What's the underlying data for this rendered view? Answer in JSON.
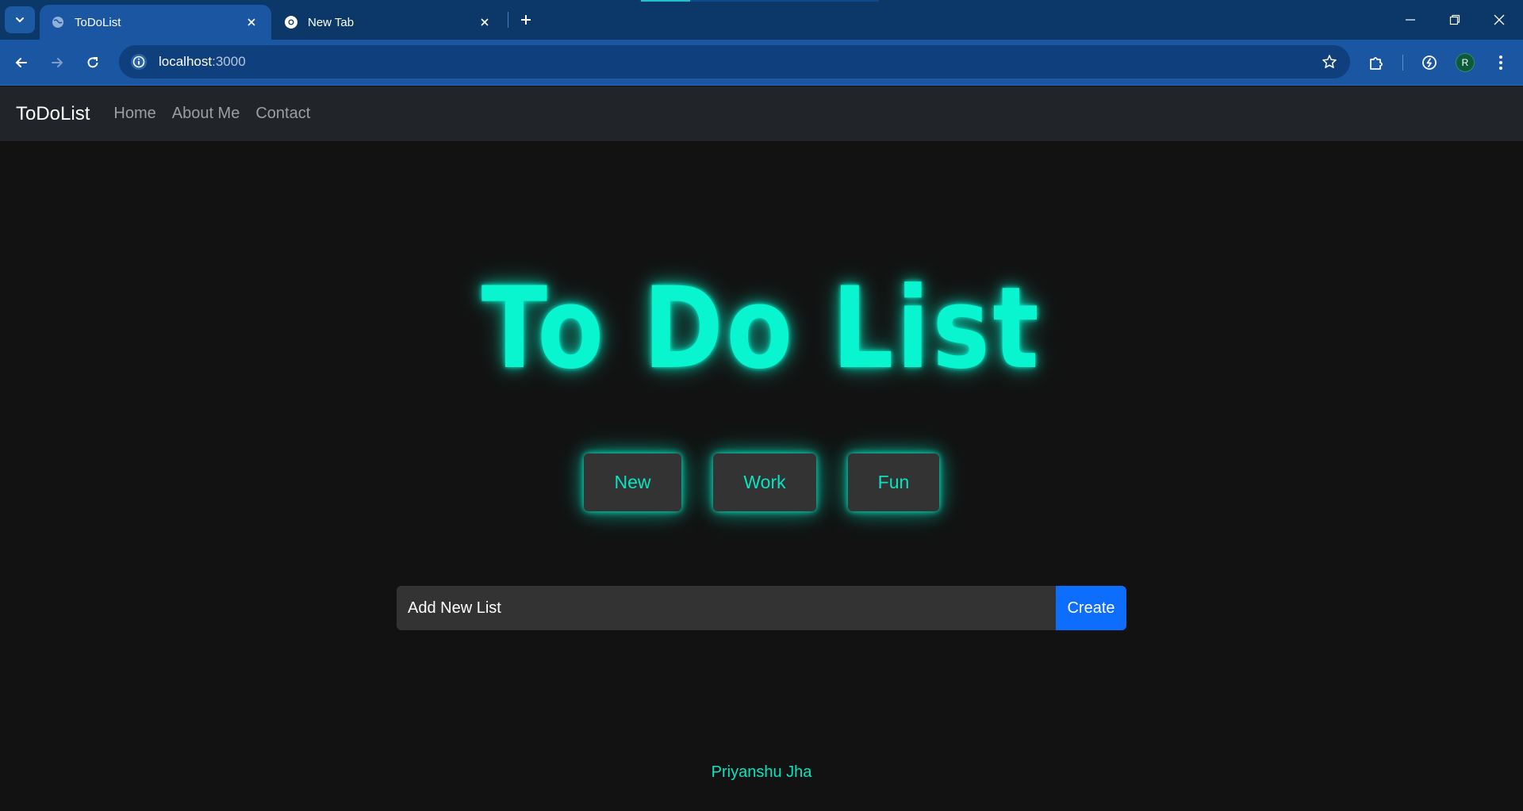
{
  "browser": {
    "tabs": [
      {
        "title": "ToDoList",
        "active": true
      },
      {
        "title": "New Tab",
        "active": false
      }
    ],
    "url_host": "localhost",
    "url_port": ":3000",
    "profile_initial": "R"
  },
  "navbar": {
    "brand": "ToDoList",
    "links": [
      "Home",
      "About Me",
      "Contact"
    ]
  },
  "hero": {
    "title": "To Do List"
  },
  "lists": [
    "New",
    "Work",
    "Fun"
  ],
  "form": {
    "placeholder": "Add New List",
    "submit_label": "Create"
  },
  "footer": {
    "author": "Priyanshu Jha"
  },
  "colors": {
    "accent": "#08f5cf",
    "primary_button": "#0d6efd",
    "background": "#121212",
    "navbar": "#212529"
  }
}
